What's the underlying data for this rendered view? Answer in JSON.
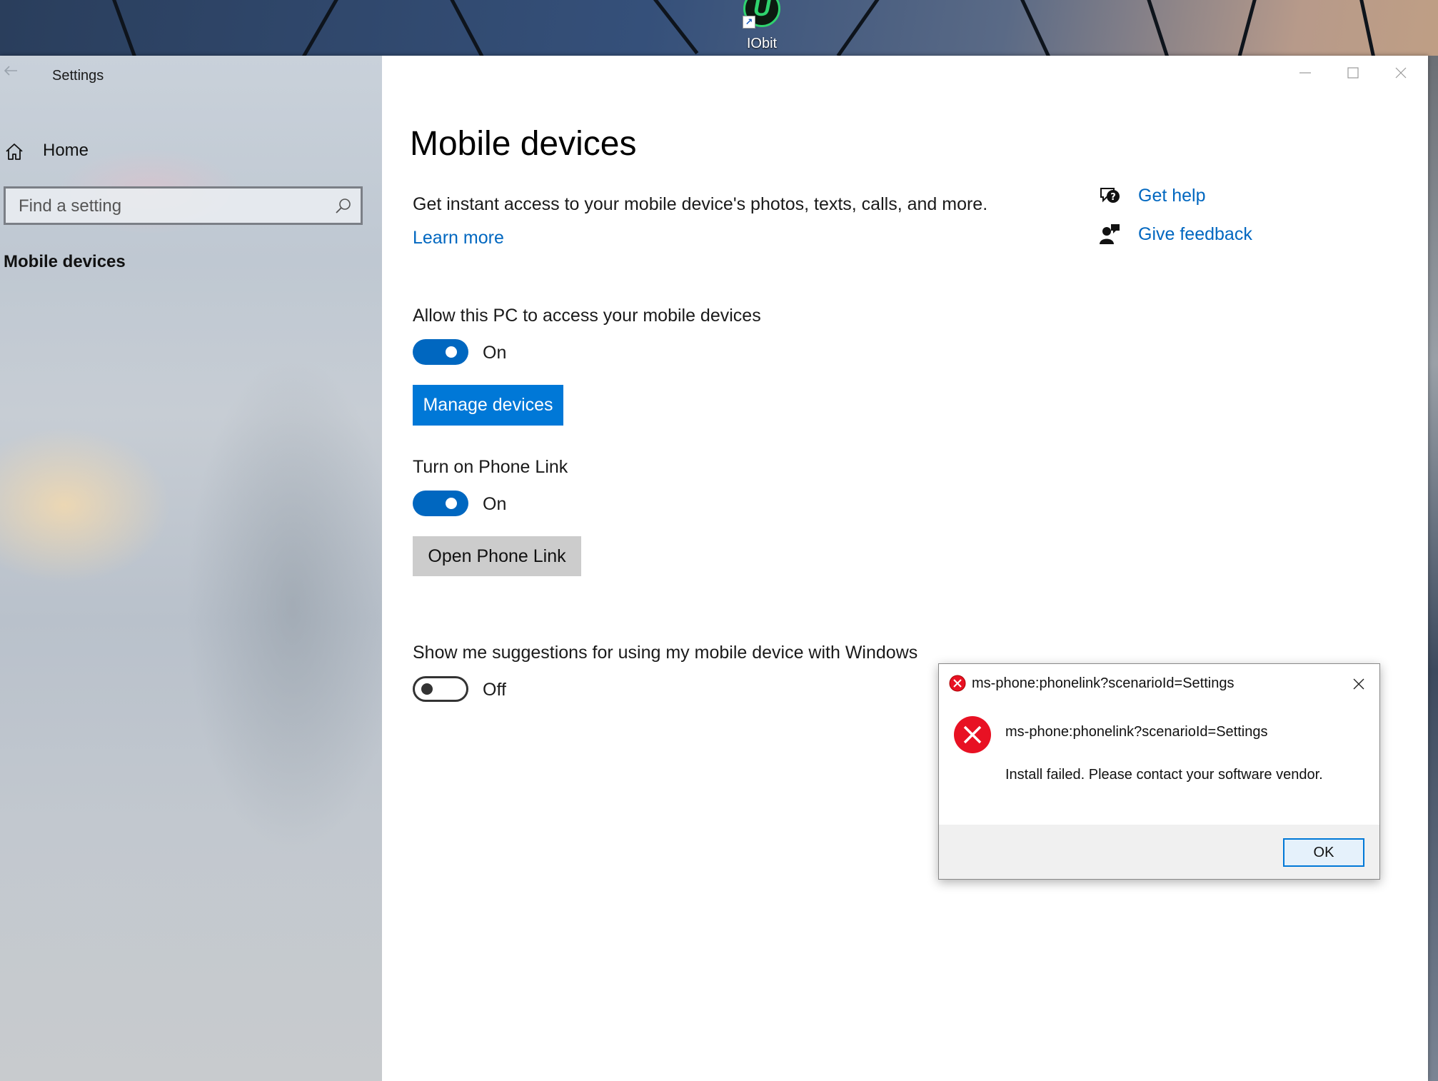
{
  "desktop": {
    "icon_label": "IObit"
  },
  "window": {
    "title": "Settings"
  },
  "sidebar": {
    "home_label": "Home",
    "search_placeholder": "Find a setting",
    "active_item": "Mobile devices"
  },
  "main": {
    "title": "Mobile devices",
    "description": "Get instant access to your mobile device's photos, texts, calls, and more.",
    "learn_more": "Learn more",
    "help_links": {
      "get_help": "Get help",
      "give_feedback": "Give feedback"
    },
    "settings": {
      "allow_access": {
        "label": "Allow this PC to access your mobile devices",
        "state": "On",
        "enabled": true
      },
      "manage_devices_button": "Manage devices",
      "phone_link": {
        "label": "Turn on Phone Link",
        "state": "On",
        "enabled": true
      },
      "open_phone_link_button": "Open Phone Link",
      "suggestions": {
        "label": "Show me suggestions for using my mobile device with Windows",
        "state": "Off",
        "enabled": false
      }
    }
  },
  "dialog": {
    "title": "ms-phone:phonelink?scenarioId=Settings",
    "message_title": "ms-phone:phonelink?scenarioId=Settings",
    "message_body": "Install failed. Please contact your software vendor.",
    "ok_label": "OK"
  },
  "colors": {
    "accent": "#0078d7",
    "link": "#0067c0",
    "error": "#e81123"
  }
}
